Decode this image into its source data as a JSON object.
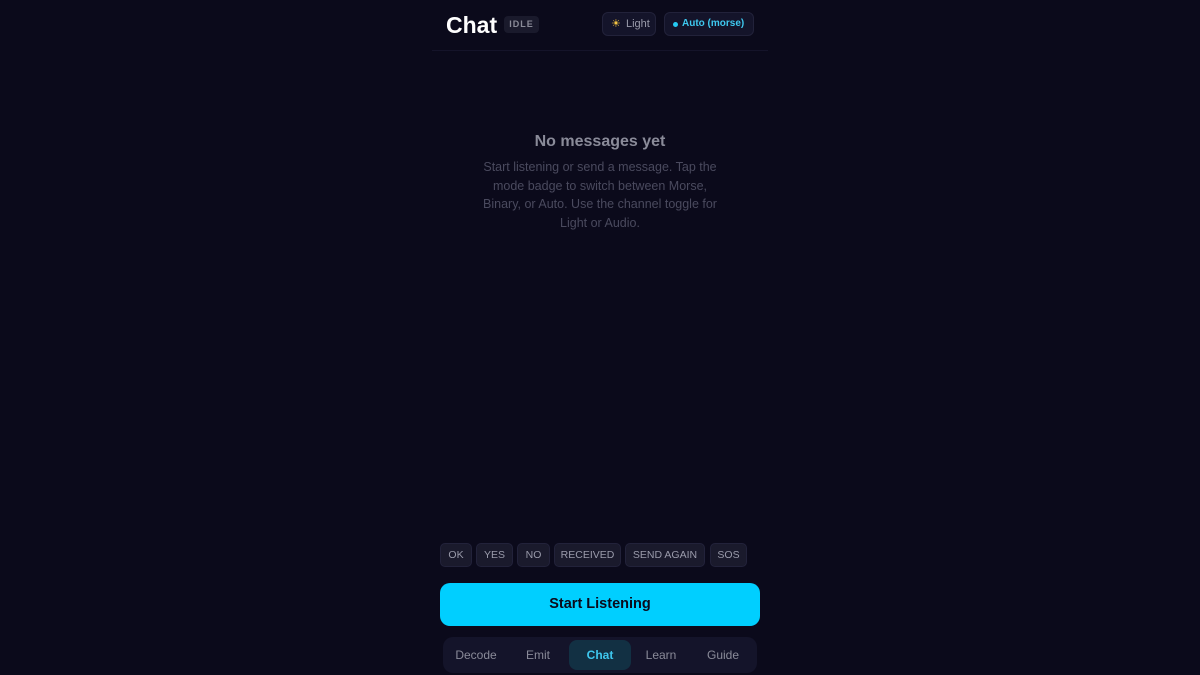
{
  "header": {
    "title": "Chat",
    "status": "IDLE",
    "channel_icon": "sun-icon",
    "channel_label": "Light",
    "mode_label": "Auto (morse)"
  },
  "empty_state": {
    "title": "No messages yet",
    "description": "Start listening or send a message. Tap the mode badge to switch between Morse, Binary, or Auto. Use the channel toggle for Light or Audio."
  },
  "quick_replies": [
    "OK",
    "YES",
    "NO",
    "RECEIVED",
    "SEND AGAIN",
    "SOS"
  ],
  "primary_action": {
    "label": "Start Listening"
  },
  "nav": {
    "tabs": [
      {
        "label": "Decode"
      },
      {
        "label": "Emit"
      },
      {
        "label": "Chat"
      },
      {
        "label": "Learn"
      },
      {
        "label": "Guide"
      }
    ],
    "active": "Chat"
  },
  "colors": {
    "background": "#0b0a1b",
    "accent": "#00cfff",
    "accent_text": "#3ec8ef"
  }
}
